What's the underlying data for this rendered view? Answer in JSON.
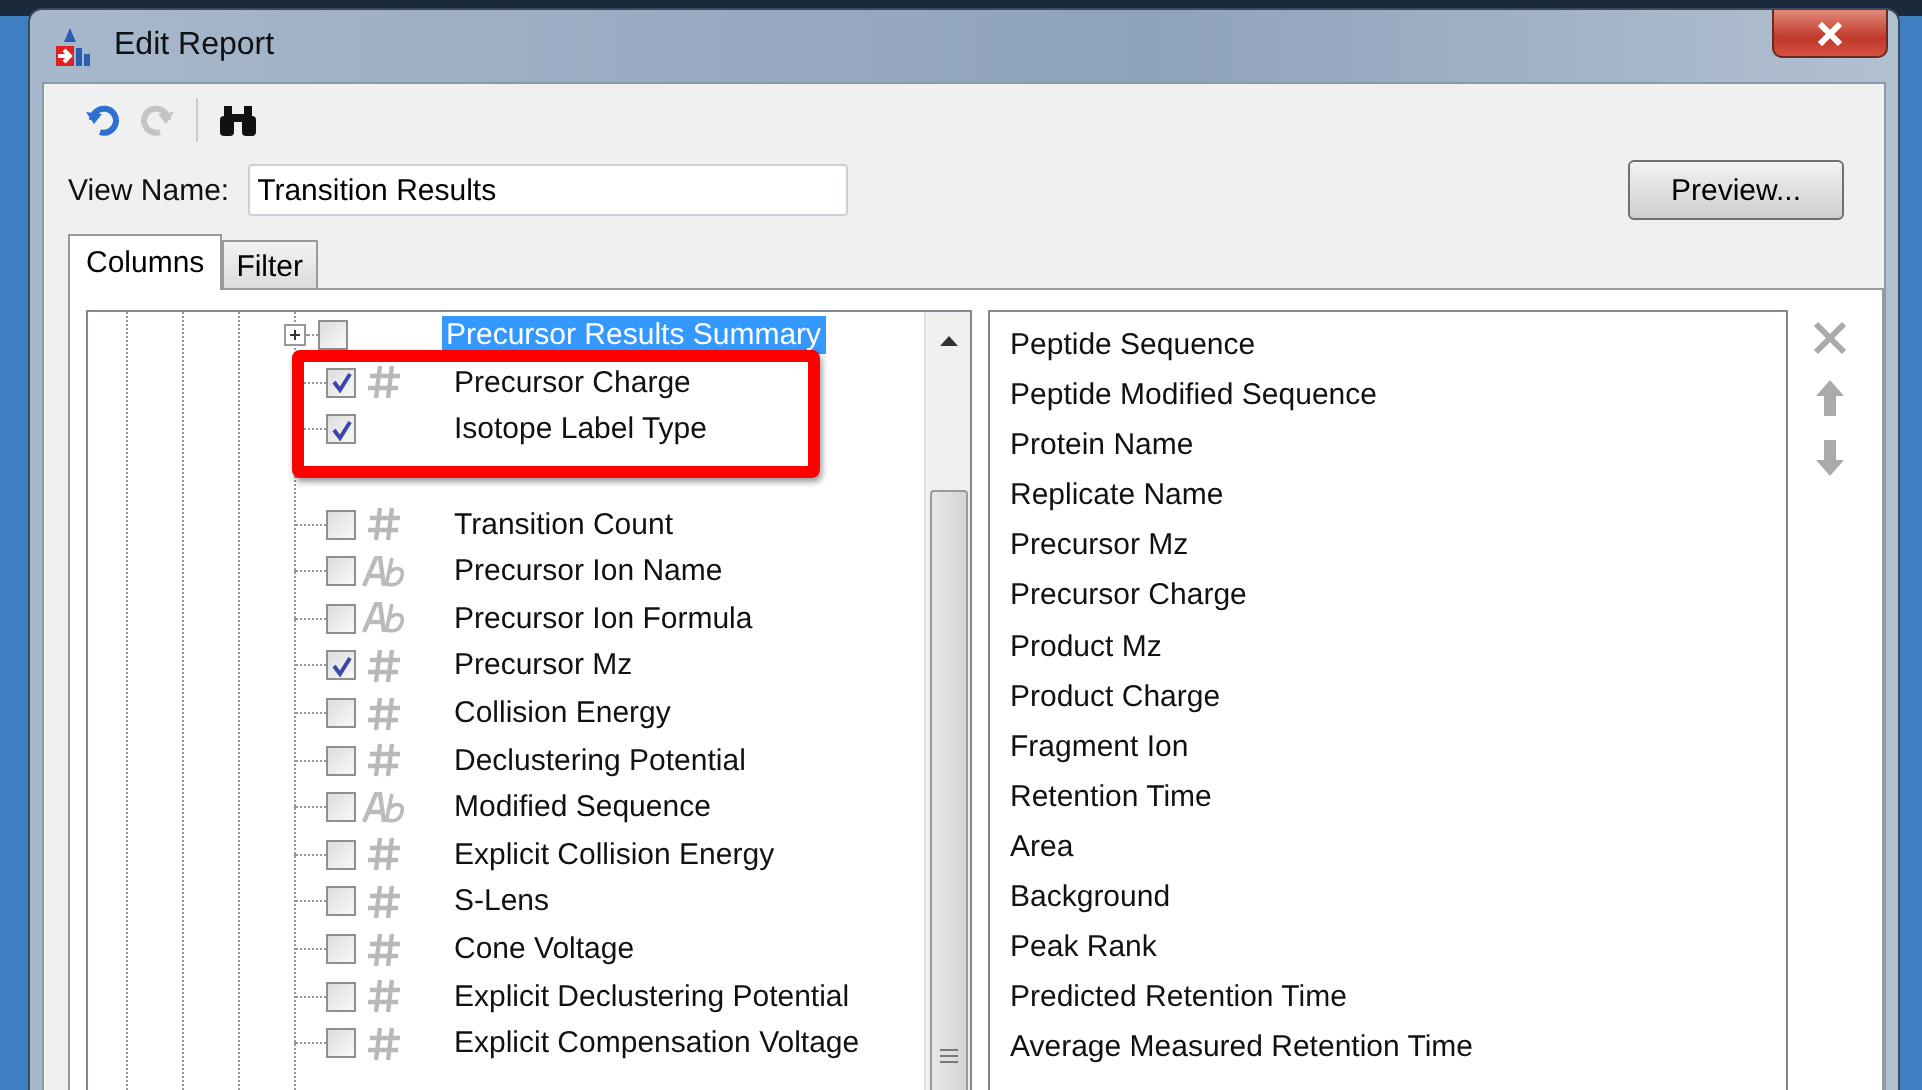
{
  "window": {
    "title": "Edit Report"
  },
  "toolbar": [
    {
      "kind": "undo",
      "disabled": false
    },
    {
      "kind": "redo",
      "disabled": true
    },
    {
      "kind": "find",
      "disabled": false
    }
  ],
  "view_name": {
    "label": "View Name:",
    "value": "Transition Results"
  },
  "preview_button": "Preview...",
  "tabs": [
    {
      "label": "Columns",
      "selected": true
    },
    {
      "label": "Filter",
      "selected": false
    }
  ],
  "tree": {
    "items": [
      {
        "label": "Precursor Results Summary",
        "kind": "group",
        "expanded": false,
        "checked": false,
        "selected": true
      },
      {
        "label": "Precursor Charge",
        "kind": "number",
        "checked": true,
        "selected": false
      },
      {
        "label": "Isotope Label Type",
        "kind": "plain",
        "checked": true,
        "selected": false
      },
      {
        "kind": "covered"
      },
      {
        "label": "Transition Count",
        "kind": "number",
        "checked": false,
        "selected": false
      },
      {
        "label": "Precursor Ion Name",
        "kind": "text",
        "checked": false,
        "selected": false
      },
      {
        "label": "Precursor Ion Formula",
        "kind": "text",
        "checked": false,
        "selected": false
      },
      {
        "label": "Precursor Mz",
        "kind": "number",
        "checked": true,
        "selected": false
      },
      {
        "label": "Collision Energy",
        "kind": "number",
        "checked": false,
        "selected": false
      },
      {
        "label": "Declustering Potential",
        "kind": "number",
        "checked": false,
        "selected": false
      },
      {
        "label": "Modified Sequence",
        "kind": "text",
        "checked": false,
        "selected": false
      },
      {
        "label": "Explicit Collision Energy",
        "kind": "number",
        "checked": false,
        "selected": false
      },
      {
        "label": "S-Lens",
        "kind": "number",
        "checked": false,
        "selected": false
      },
      {
        "label": "Cone Voltage",
        "kind": "number",
        "checked": false,
        "selected": false
      },
      {
        "label": "Explicit Declustering Potential",
        "kind": "number",
        "checked": false,
        "selected": false
      },
      {
        "label": "Explicit Compensation Voltage",
        "kind": "number",
        "checked": false,
        "selected": false
      }
    ]
  },
  "selected_columns": [
    "Peptide Sequence",
    "Peptide Modified Sequence",
    "Protein Name",
    "Replicate Name",
    "Precursor Mz",
    "Precursor Charge",
    "Product Mz",
    "Product Charge",
    "Fragment Ion",
    "Retention Time",
    "Area",
    "Background",
    "Peak Rank",
    "Predicted Retention Time",
    "Average Measured Retention Time"
  ],
  "column_buttons": [
    {
      "kind": "remove",
      "disabled": true
    },
    {
      "kind": "up",
      "disabled": true
    },
    {
      "kind": "down",
      "disabled": true
    }
  ]
}
